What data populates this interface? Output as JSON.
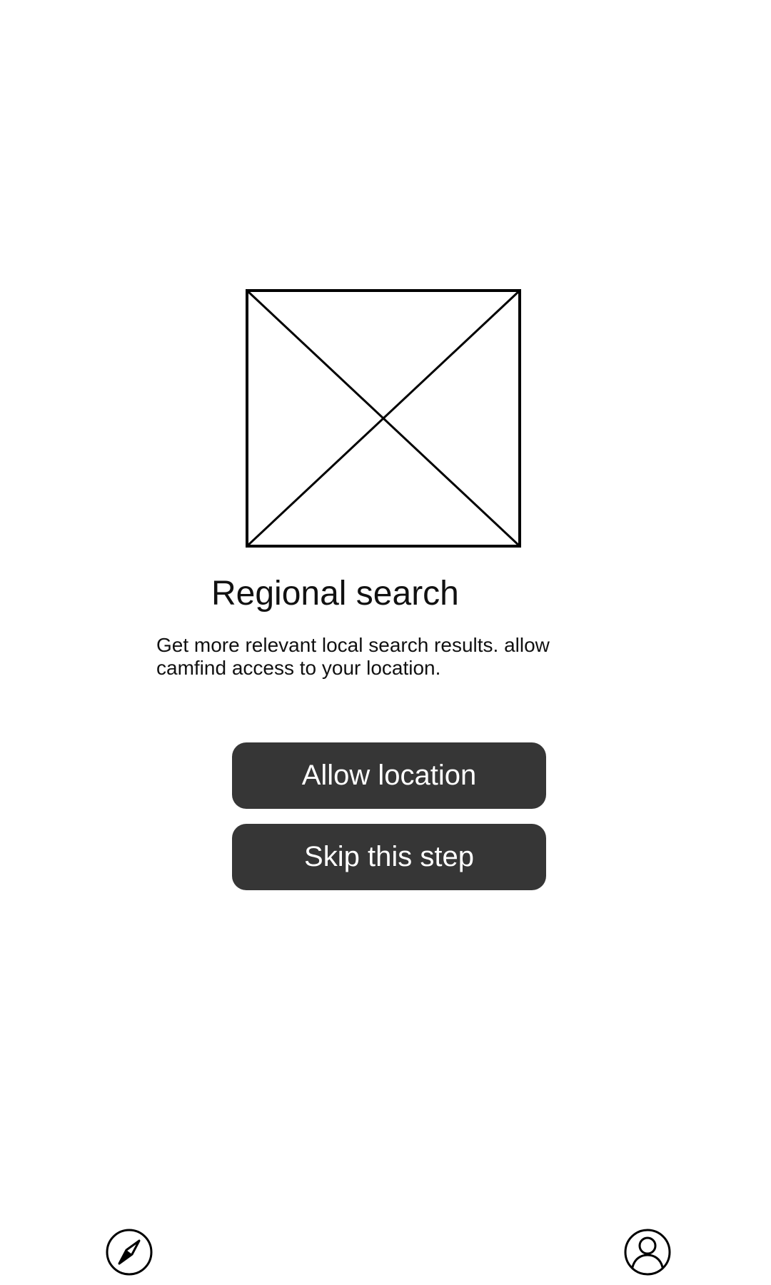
{
  "onboarding": {
    "image_placeholder_icon": "image-placeholder-icon",
    "title": "Regional search",
    "description": "Get more relevant local search results. allow camfind access to your location.",
    "allow_button_label": "Allow location",
    "skip_button_label": "Skip this step"
  },
  "bottom_nav": {
    "left_icon": "compass-icon",
    "right_icon": "profile-icon"
  },
  "colors": {
    "button_background": "#363636",
    "button_text": "#ffffff",
    "text": "#111111",
    "background": "#ffffff"
  }
}
